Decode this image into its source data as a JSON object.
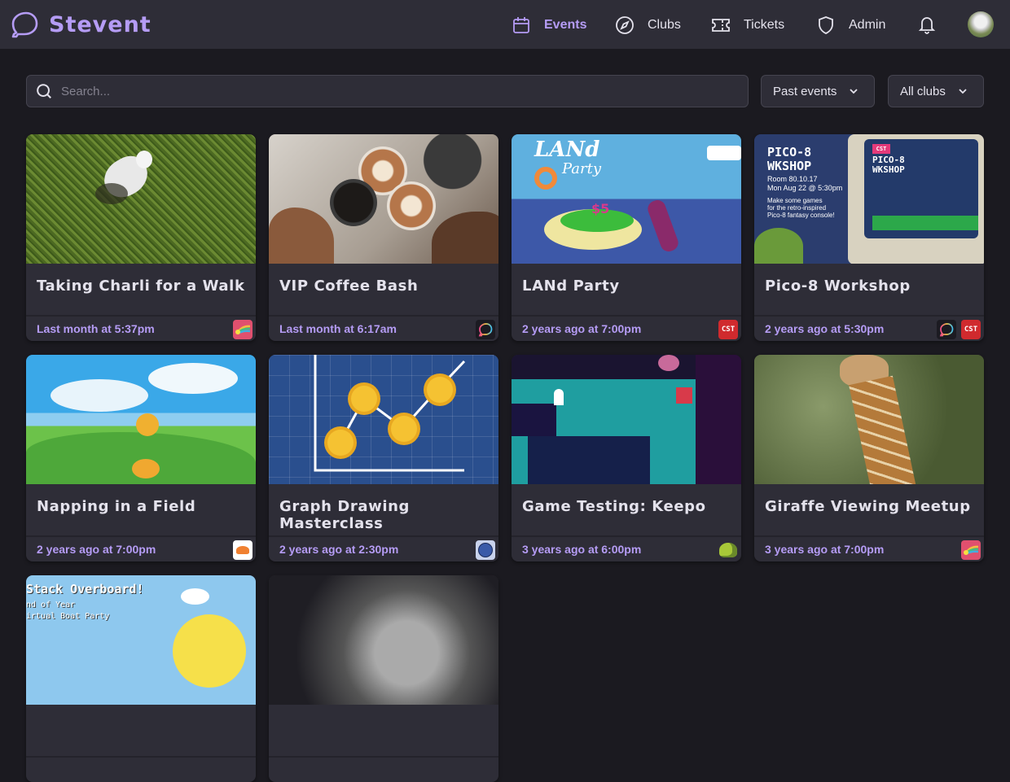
{
  "app": {
    "name": "Stevent"
  },
  "nav": {
    "items": [
      {
        "label": "Events",
        "icon": "calendar-icon",
        "active": true
      },
      {
        "label": "Clubs",
        "icon": "compass-icon",
        "active": false
      },
      {
        "label": "Tickets",
        "icon": "ticket-icon",
        "active": false
      },
      {
        "label": "Admin",
        "icon": "shield-icon",
        "active": false
      }
    ],
    "notifications_icon": "bell-icon",
    "avatar_icon": "user-avatar"
  },
  "filters": {
    "search_placeholder": "Search...",
    "search_value": "",
    "time_filter": "Past events",
    "club_filter": "All clubs"
  },
  "colors": {
    "accent": "#b59cf5",
    "background": "#1b1a20",
    "surface": "#2e2d37"
  },
  "events": [
    {
      "title": "Taking Charli for a Walk",
      "date": "Last month at 5:37pm",
      "clubs": [
        "rainbow-star"
      ],
      "image": "dog-on-grass"
    },
    {
      "title": "VIP Coffee Bash",
      "date": "Last month at 6:17am",
      "clubs": [
        "stevent"
      ],
      "image": "coffee-cups"
    },
    {
      "title": "LANd Party",
      "date": "2 years ago at 7:00pm",
      "clubs": [
        "cst"
      ],
      "image": "land-party-island"
    },
    {
      "title": "Pico-8 Workshop",
      "date": "2 years ago at 5:30pm",
      "clubs": [
        "stevent",
        "cst"
      ],
      "image": "pico8-monitor"
    },
    {
      "title": "Napping in a Field",
      "date": "2 years ago at 7:00pm",
      "clubs": [
        "crab"
      ],
      "image": "field-sky"
    },
    {
      "title": "Graph Drawing Masterclass",
      "date": "2 years ago at 2:30pm",
      "clubs": [
        "planet"
      ],
      "image": "sunflower-graph"
    },
    {
      "title": "Game Testing: Keepo",
      "date": "3 years ago at 6:00pm",
      "clubs": [
        "snail"
      ],
      "image": "pixel-game"
    },
    {
      "title": "Giraffe Viewing Meetup",
      "date": "3 years ago at 7:00pm",
      "clubs": [
        "rainbow-star"
      ],
      "image": "giraffe"
    },
    {
      "title": "",
      "date": "",
      "clubs": [],
      "image": "stack-overboard",
      "image_text": [
        "Stack Overboard!",
        "nd of Year",
        "irtual Boat Party"
      ]
    },
    {
      "title": "",
      "date": "",
      "clubs": [],
      "image": "knight-bw"
    }
  ],
  "club_badges": {
    "cst": "CST"
  }
}
